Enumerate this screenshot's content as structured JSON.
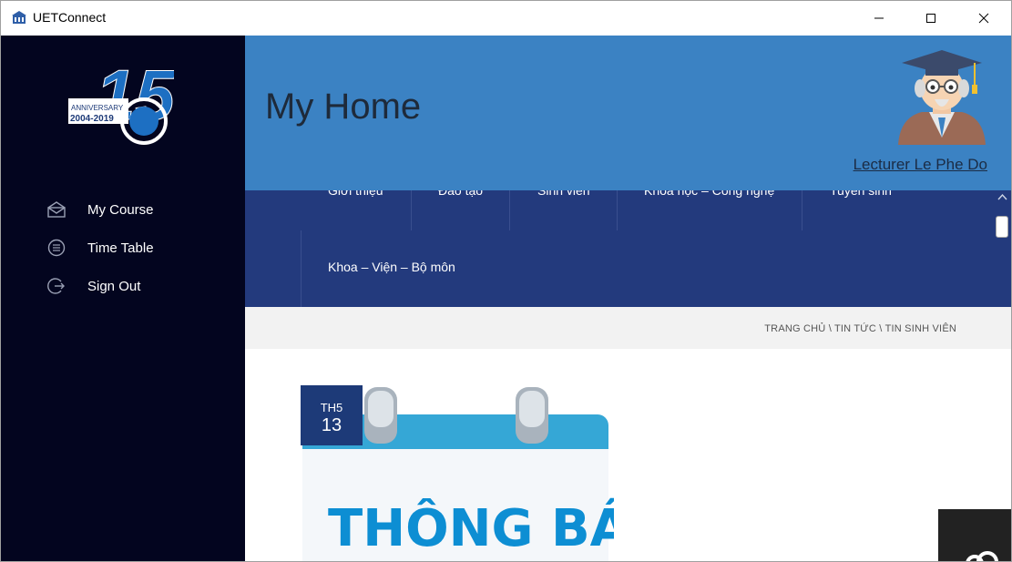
{
  "window": {
    "title": "UETConnect"
  },
  "sidebar": {
    "logo_text": "ANNIVERSARY 2004-2019",
    "items": [
      {
        "label": "My Course",
        "icon": "mail-open-icon"
      },
      {
        "label": "Time Table",
        "icon": "list-circle-icon"
      },
      {
        "label": "Sign Out",
        "icon": "sign-out-icon"
      }
    ]
  },
  "header": {
    "title": "My Home",
    "user_link": "Lecturer Le Phe Do",
    "avatar_icon": "professor-avatar"
  },
  "web": {
    "menu": [
      "Giới thiệu",
      "Đào tạo",
      "Sinh viên",
      "Khoa học – Công nghệ",
      "Tuyển sinh",
      "Khoa – Viện – Bộ môn"
    ],
    "breadcrumb": "TRANG CHỦ \\ TIN TỨC \\ TIN SINH VIÊN",
    "post": {
      "month": "TH5",
      "day": "13",
      "image_text": "THÔNG BÁO"
    }
  },
  "colors": {
    "sidebar_bg": "#03051f",
    "header_bg": "#3b82c3",
    "menu_bg": "#233a7d",
    "date_badge_bg": "#1d3a78"
  }
}
